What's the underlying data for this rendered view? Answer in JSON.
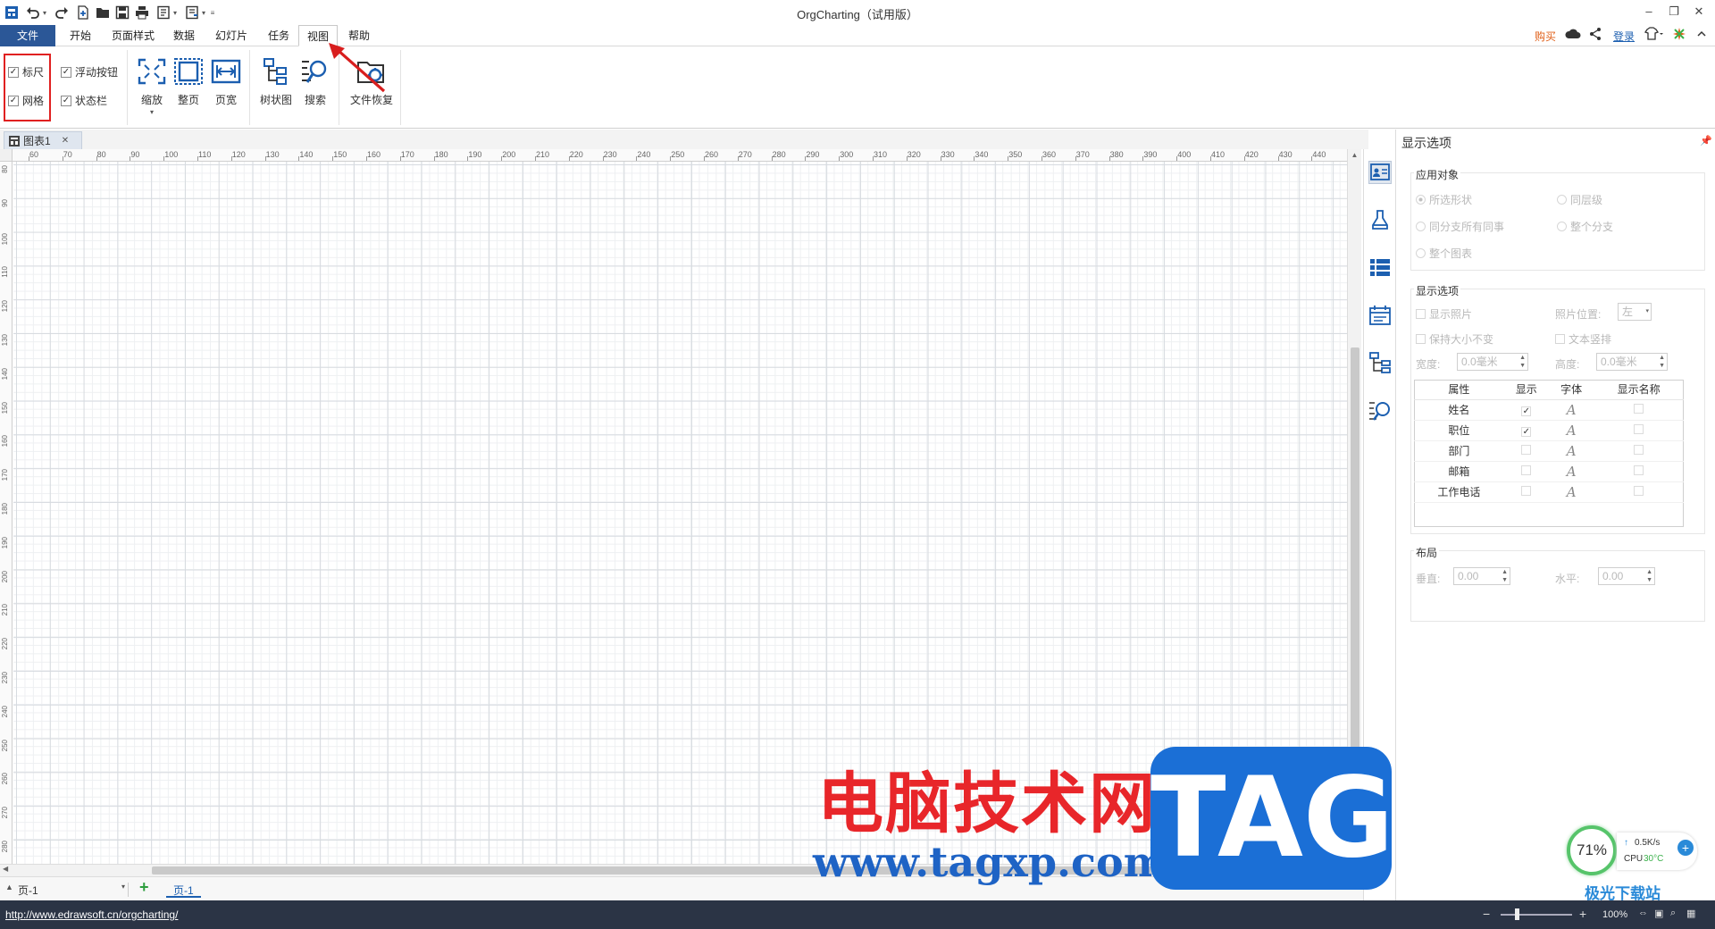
{
  "app": {
    "title": "OrgCharting（试用版）"
  },
  "menu": {
    "tabs": [
      {
        "label": "文件"
      },
      {
        "label": "开始"
      },
      {
        "label": "页面样式"
      },
      {
        "label": "数据"
      },
      {
        "label": "幻灯片"
      },
      {
        "label": "任务"
      },
      {
        "label": "视图"
      },
      {
        "label": "帮助"
      }
    ],
    "active_tab": "视图",
    "buy": "购买",
    "login": "登录"
  },
  "ribbon": {
    "checkboxes": [
      {
        "label": "标尺",
        "checked": true
      },
      {
        "label": "网格",
        "checked": true
      },
      {
        "label": "浮动按钮",
        "checked": true
      },
      {
        "label": "状态栏",
        "checked": true
      }
    ],
    "check_mark": "✓",
    "buttons": [
      {
        "label": "缩放"
      },
      {
        "label": "整页"
      },
      {
        "label": "页宽"
      },
      {
        "label": "树状图"
      },
      {
        "label": "搜索"
      },
      {
        "label": "文件恢复"
      }
    ]
  },
  "document": {
    "tab_label": "图表1",
    "close_glyph": "✕"
  },
  "rulers": {
    "horizontal": [
      "60",
      "70",
      "80",
      "90",
      "100",
      "110",
      "120",
      "130",
      "140",
      "150",
      "160",
      "170",
      "180",
      "190",
      "200",
      "210",
      "220",
      "230",
      "240",
      "250",
      "260",
      "270",
      "280",
      "290",
      "300",
      "310",
      "320",
      "330",
      "340",
      "350",
      "360",
      "370",
      "380",
      "390",
      "400",
      "410",
      "420",
      "430",
      "440"
    ],
    "vertical": [
      "80",
      "90",
      "100",
      "110",
      "120",
      "130",
      "140",
      "150",
      "160",
      "170",
      "180",
      "190",
      "200",
      "210",
      "220",
      "230",
      "240",
      "250",
      "260",
      "270",
      "280"
    ]
  },
  "pages": {
    "selector": "页-1",
    "add_glyph": "+",
    "tab": "页-1"
  },
  "status": {
    "url": "http://www.edrawsoft.cn/orgcharting/",
    "zoom": "100%"
  },
  "panel": {
    "title": "显示选项",
    "apply_group": {
      "title": "应用对象",
      "options": [
        "所选形状",
        "同层级",
        "同分支所有同事",
        "整个分支",
        "整个图表"
      ]
    },
    "display_group": {
      "title": "显示选项",
      "show_photo": "显示照片",
      "photo_position_label": "照片位置:",
      "photo_position_value": "左",
      "keep_size": "保持大小不变",
      "vertical_text": "文本竖排",
      "width_label": "宽度:",
      "width_value": "0.0毫米",
      "height_label": "高度:",
      "height_value": "0.0毫米",
      "table_headers": [
        "属性",
        "显示",
        "字体",
        "显示名称"
      ],
      "rows": [
        {
          "name": "姓名",
          "show": true
        },
        {
          "name": "职位",
          "show": true
        },
        {
          "name": "部门",
          "show": false
        },
        {
          "name": "邮箱",
          "show": false
        },
        {
          "name": "工作电话",
          "show": false
        }
      ],
      "font_glyph": "A"
    },
    "layout_group": {
      "title": "布局",
      "vertical_label": "垂直:",
      "vertical_value": "0.00",
      "horizontal_label": "水平:",
      "horizontal_value": "0.00"
    }
  },
  "watermark": {
    "cn_text": "电脑技术网",
    "url_text": "www.tagxp.com",
    "tag_text": "TAG",
    "site_text": "极光下载站"
  },
  "perf_widget": {
    "percent": "71%",
    "net_speed": "0.5K/s",
    "cpu_label": "CPU",
    "cpu_temp": "30°C"
  },
  "colors": {
    "file_tab": "#2b5797",
    "highlight_red": "#e02020",
    "statusbar": "#2b3445",
    "icon_blue": "#1c5fb0"
  }
}
